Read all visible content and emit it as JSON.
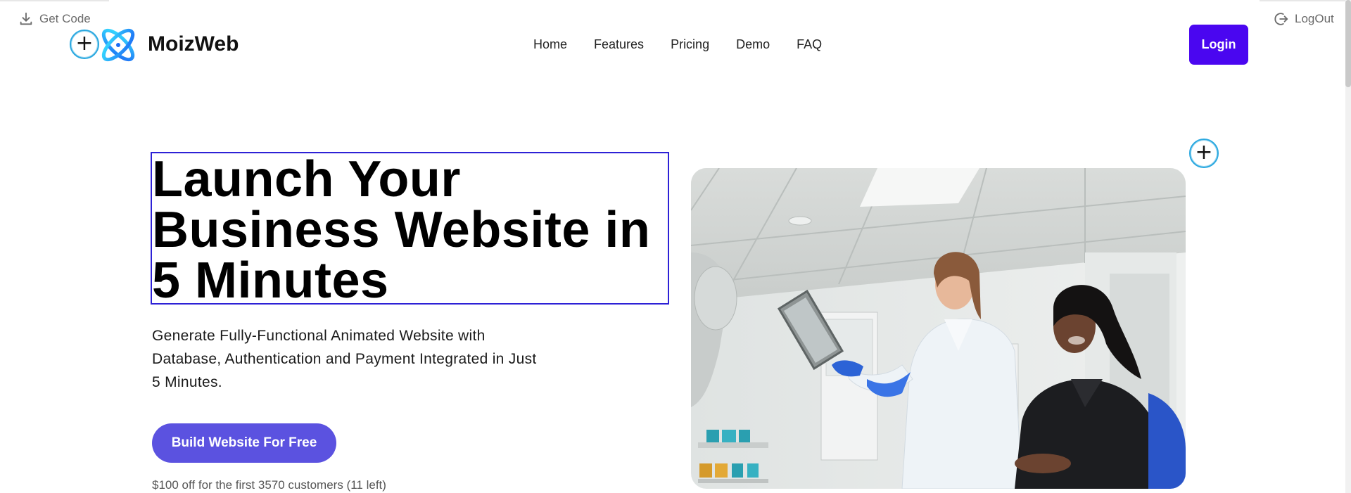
{
  "topbar": {
    "get_code": "Get Code",
    "logout": "LogOut"
  },
  "header": {
    "brand": "MoizWeb",
    "nav": [
      "Home",
      "Features",
      "Pricing",
      "Demo",
      "FAQ"
    ],
    "login": "Login"
  },
  "hero": {
    "headline_lines": [
      "Launch Your",
      "Business Website in",
      "5 Minutes"
    ],
    "subtext": "Generate Fully-Functional Animated Website with Database, Authentication and Payment Integrated in Just 5 Minutes.",
    "cta": "Build Website For Free",
    "offer": "$100 off for the first 3570 customers (11 left)"
  },
  "colors": {
    "login_bg": "#4a06f0",
    "cta_bg": "#5b52e0",
    "selection_border": "#2d21d6",
    "add_circle_border": "#2aa8e0"
  },
  "icons": [
    "download-icon",
    "logout-icon",
    "plus-icon",
    "logo-icon"
  ]
}
